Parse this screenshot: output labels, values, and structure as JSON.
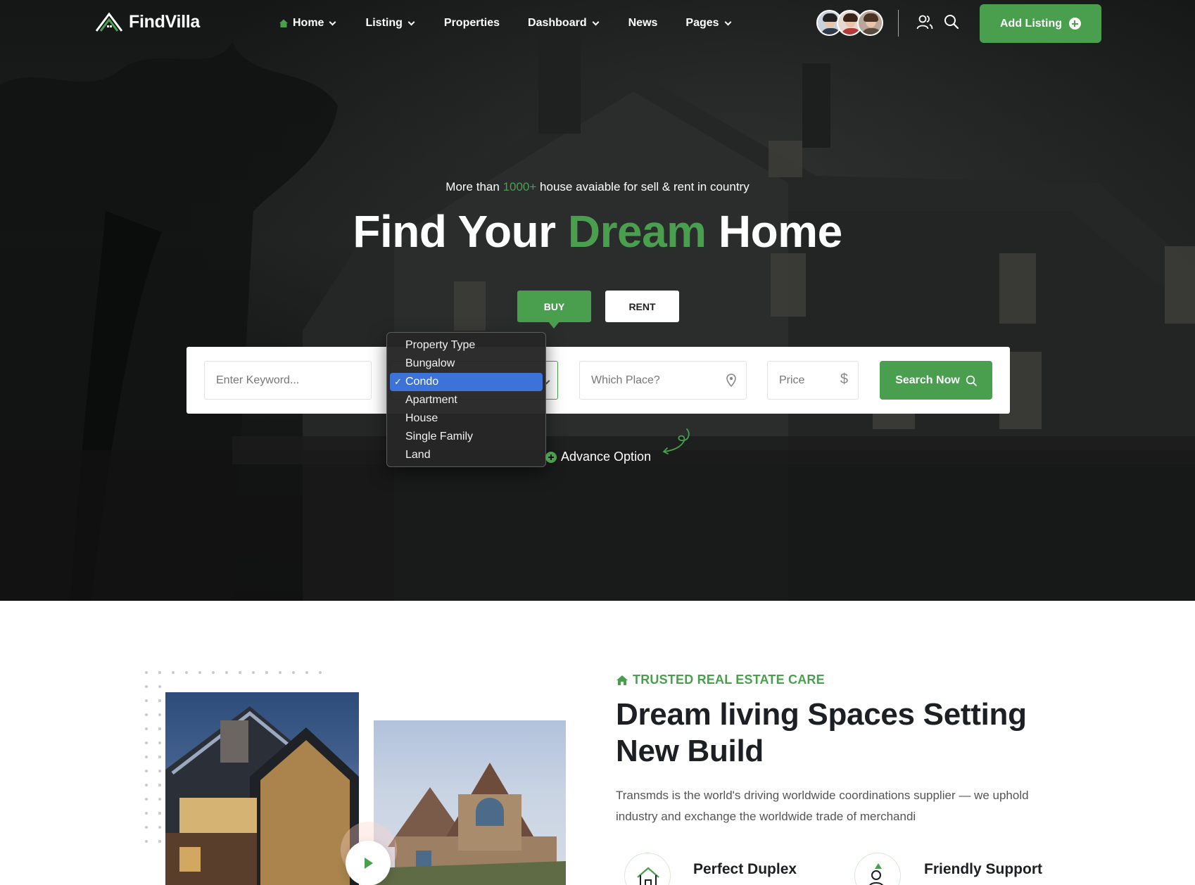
{
  "brand": {
    "name": "FindVilla"
  },
  "nav": {
    "items": [
      {
        "label": "Home",
        "has_dropdown": true,
        "icon": "home-icon"
      },
      {
        "label": "Listing",
        "has_dropdown": true
      },
      {
        "label": "Properties",
        "has_dropdown": false
      },
      {
        "label": "Dashboard",
        "has_dropdown": true
      },
      {
        "label": "News",
        "has_dropdown": false
      },
      {
        "label": "Pages",
        "has_dropdown": true
      }
    ],
    "add_listing": "Add Listing"
  },
  "hero": {
    "subtitle_pre": "More than",
    "subtitle_highlight": "1000+",
    "subtitle_post": "house avaiable for sell & rent in country",
    "title_pre": "Find Your",
    "title_highlight": "Dream",
    "title_post": "Home",
    "tabs": {
      "buy": "BUY",
      "rent": "RENT"
    }
  },
  "search": {
    "keyword_placeholder": "Enter Keyword...",
    "place_placeholder": "Which Place?",
    "price_placeholder": "Price",
    "price_symbol": "$",
    "button": "Search Now",
    "property_type": {
      "selected": "Condo",
      "options": [
        "Property Type",
        "Bungalow",
        "Condo",
        "Apartment",
        "House",
        "Single Family",
        "Land"
      ]
    },
    "advance_option": "Advance Option"
  },
  "about": {
    "eyebrow": "TRUSTED REAL ESTATE CARE",
    "title_line1": "Dream living Spaces Setting",
    "title_line2": "New Build",
    "description": "Transmds is the world's driving worldwide coordinations supplier — we uphold industry and exchange the worldwide trade of merchandi",
    "features": [
      {
        "title": "Perfect Duplex",
        "icon": "house-icon"
      },
      {
        "title": "Friendly Support",
        "icon": "support-icon"
      }
    ]
  },
  "colors": {
    "accent": "#4a9f4f",
    "dropdown_selected": "#3d72d8",
    "hero_bg": "#1a1b1b"
  }
}
